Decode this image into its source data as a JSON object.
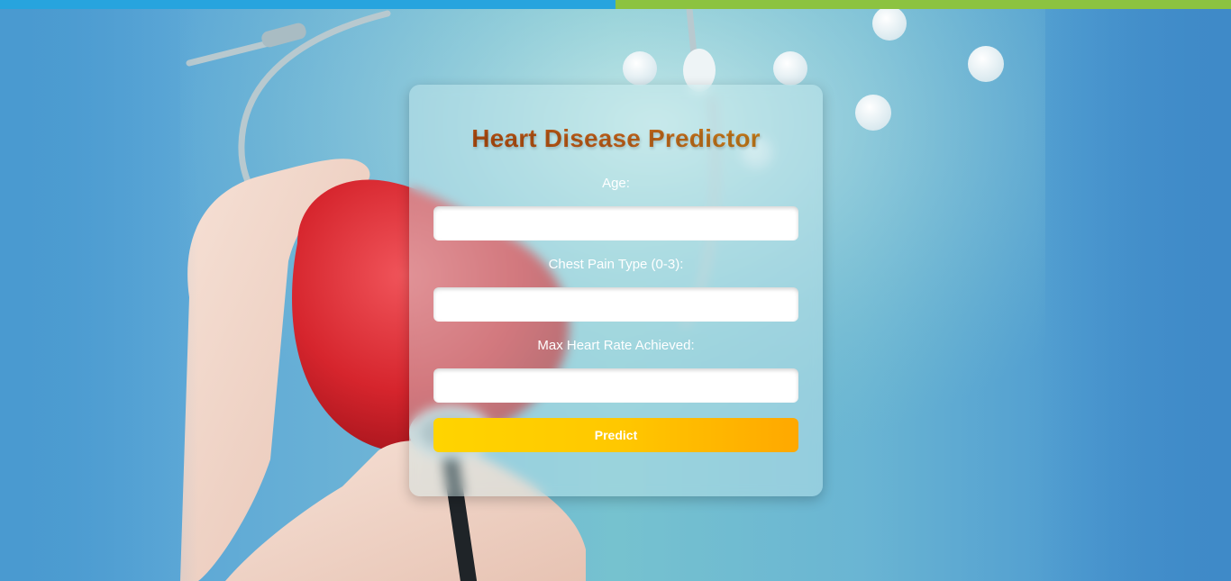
{
  "header": {
    "title": "Heart Disease Predictor"
  },
  "form": {
    "fields": [
      {
        "label": "Age:",
        "value": "",
        "placeholder": ""
      },
      {
        "label": "Chest Pain Type (0-3):",
        "value": "",
        "placeholder": ""
      },
      {
        "label": "Max Heart Rate Achieved:",
        "value": "",
        "placeholder": ""
      }
    ],
    "submit_label": "Predict"
  },
  "colors": {
    "top_bar_left": "#27a4de",
    "top_bar_right": "#8cc340",
    "title_gradient_start": "#a8420a",
    "title_gradient_end": "#c98a1a",
    "button_gradient_start": "#ffd400",
    "button_gradient_end": "#ffa800"
  },
  "background": {
    "image_subject": "hands-holding-heart-with-stethoscope-and-pills"
  }
}
